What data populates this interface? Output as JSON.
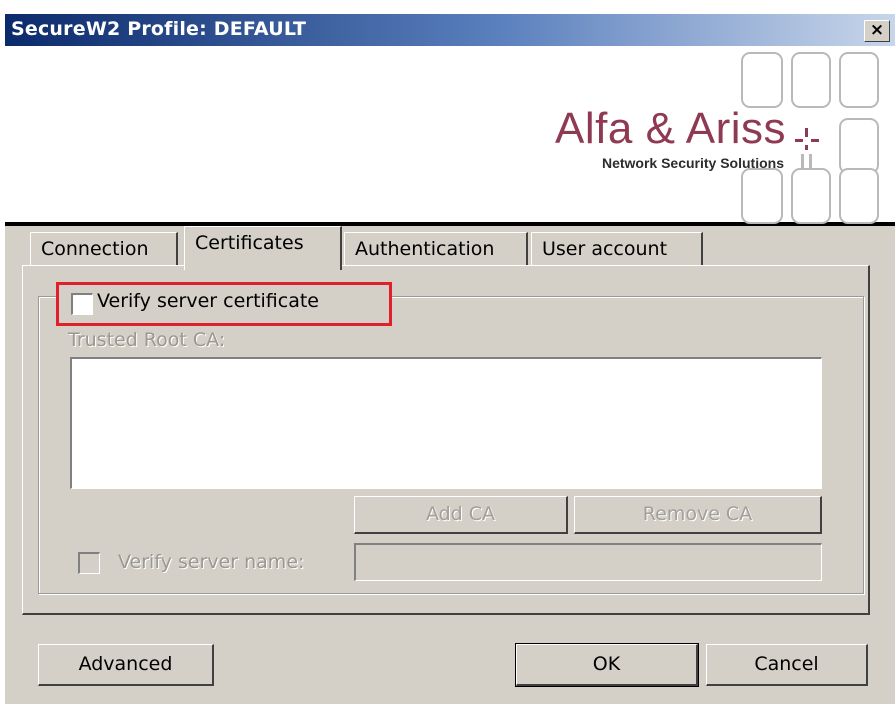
{
  "window": {
    "title": "SecureW2 Profile: DEFAULT",
    "close_label": "×"
  },
  "banner": {
    "brand_name": "Alfa & Ariss",
    "tagline": "Network Security Solutions"
  },
  "tabs": [
    {
      "label": "Connection",
      "active": false
    },
    {
      "label": "Certificates",
      "active": true
    },
    {
      "label": "Authentication",
      "active": false
    },
    {
      "label": "User account",
      "active": false
    }
  ],
  "certificates": {
    "verify_server_certificate": {
      "label": "Verify server certificate",
      "checked": false,
      "highlight_color": "#e0202a"
    },
    "trusted_root_ca_label": "Trusted Root CA:",
    "trusted_root_ca_items": [],
    "add_ca_label": "Add CA",
    "remove_ca_label": "Remove CA",
    "verify_server_name": {
      "label": "Verify server name:",
      "checked": false,
      "enabled": false,
      "value": ""
    }
  },
  "footer": {
    "advanced_label": "Advanced",
    "ok_label": "OK",
    "cancel_label": "Cancel"
  }
}
